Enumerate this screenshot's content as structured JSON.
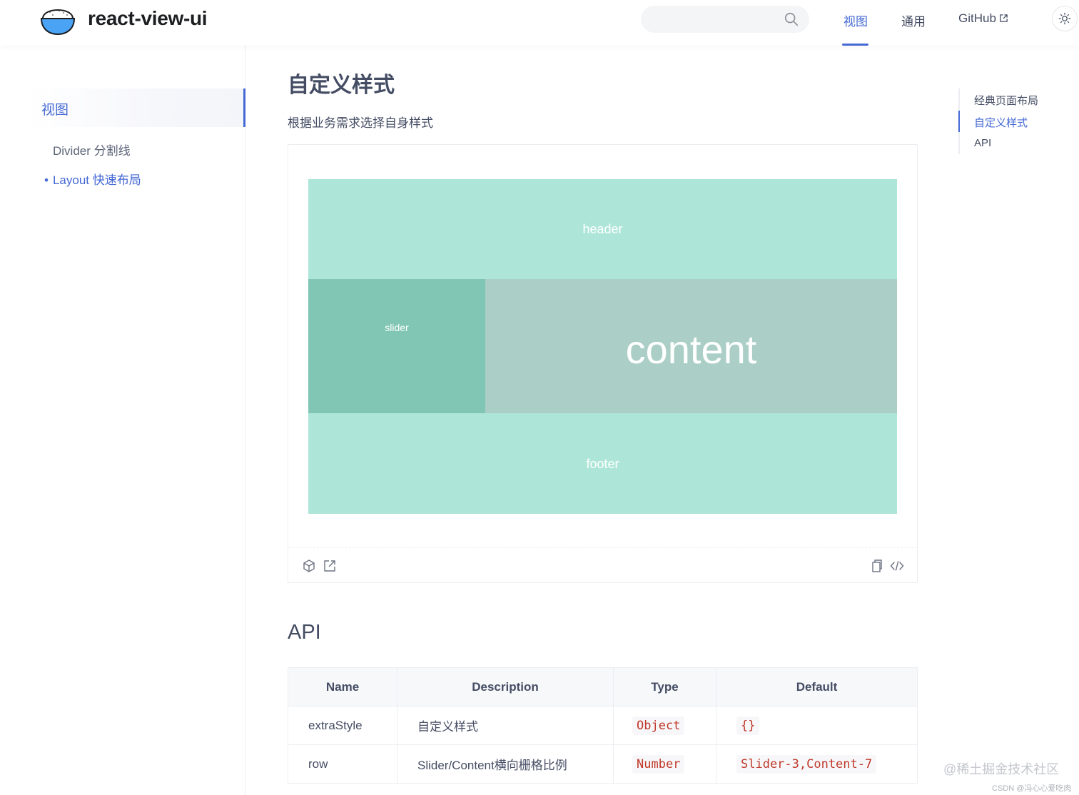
{
  "header": {
    "brand": "react-view-ui",
    "search": {
      "placeholder": ""
    },
    "nav": [
      {
        "label": "视图",
        "active": true
      },
      {
        "label": "通用",
        "active": false
      },
      {
        "label": "GitHub",
        "active": false
      }
    ]
  },
  "sidebar": {
    "group": "视图",
    "items": [
      {
        "label": "Divider 分割线",
        "active": false
      },
      {
        "label": "Layout 快速布局",
        "active": true
      }
    ]
  },
  "main": {
    "title": "自定义样式",
    "description": "根据业务需求选择自身样式",
    "demo": {
      "header": "header",
      "slider": "slider",
      "content": "content",
      "footer": "footer",
      "colors": {
        "header": "#ade6d8",
        "slider": "#81c6b4",
        "content": "#abcfc6",
        "footer": "#ade6d8"
      }
    },
    "api_title": "API",
    "table": {
      "columns": [
        "Name",
        "Description",
        "Type",
        "Default"
      ],
      "rows": [
        {
          "name": "extraStyle",
          "description": "自定义样式",
          "type": "Object",
          "default": "{}"
        },
        {
          "name": "row",
          "description": "Slider/Content横向栅格比例",
          "type": "Number",
          "default": "Slider-3,Content-7"
        }
      ]
    }
  },
  "toc": {
    "items": [
      {
        "label": "经典页面布局",
        "active": false
      },
      {
        "label": "自定义样式",
        "active": true
      },
      {
        "label": "API",
        "active": false
      }
    ]
  },
  "watermark": {
    "main": "@稀土掘金技术社区",
    "sub": "CSDN @冯心心爱吃肉"
  },
  "colors": {
    "accent": "#4569d4",
    "text": "#454d64"
  }
}
